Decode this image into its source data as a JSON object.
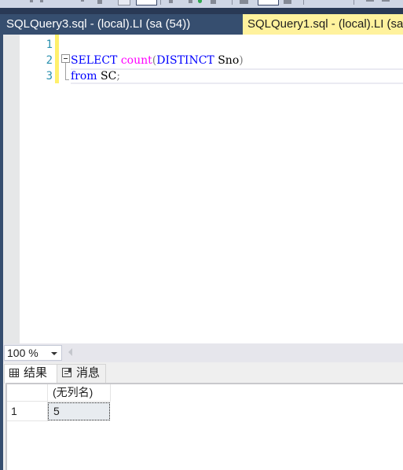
{
  "tabs": [
    {
      "label": "SQLQuery3.sql - (local).LI (sa (54))",
      "active": false
    },
    {
      "label": "SQLQuery1.sql - (local).LI (sa",
      "active": true
    }
  ],
  "editor": {
    "line_numbers": [
      "1",
      "2",
      "3"
    ],
    "lines": [
      {
        "tokens": []
      },
      {
        "tokens": [
          {
            "text": "SELECT",
            "type": "keyword"
          },
          {
            "text": " ",
            "type": "plain"
          },
          {
            "text": "count",
            "type": "function"
          },
          {
            "text": "(",
            "type": "operator"
          },
          {
            "text": "DISTINCT",
            "type": "keyword"
          },
          {
            "text": " Sno",
            "type": "plain"
          },
          {
            "text": ")",
            "type": "operator"
          }
        ]
      },
      {
        "tokens": [
          {
            "text": "from",
            "type": "keyword"
          },
          {
            "text": " SC",
            "type": "plain"
          },
          {
            "text": ";",
            "type": "operator"
          }
        ]
      }
    ],
    "colors": {
      "keyword": "#0000ff",
      "function": "#ff00ff",
      "operator": "#808080",
      "line_number": "#2b91af"
    }
  },
  "zoom": {
    "value": "100 %"
  },
  "results": {
    "tabs": [
      {
        "label": "结果",
        "icon": "grid-icon",
        "active": true
      },
      {
        "label": "消息",
        "icon": "messages-icon",
        "active": false
      }
    ],
    "columns": [
      "(无列名)"
    ],
    "rows": [
      {
        "num": "1",
        "cells": [
          "5"
        ]
      }
    ]
  }
}
